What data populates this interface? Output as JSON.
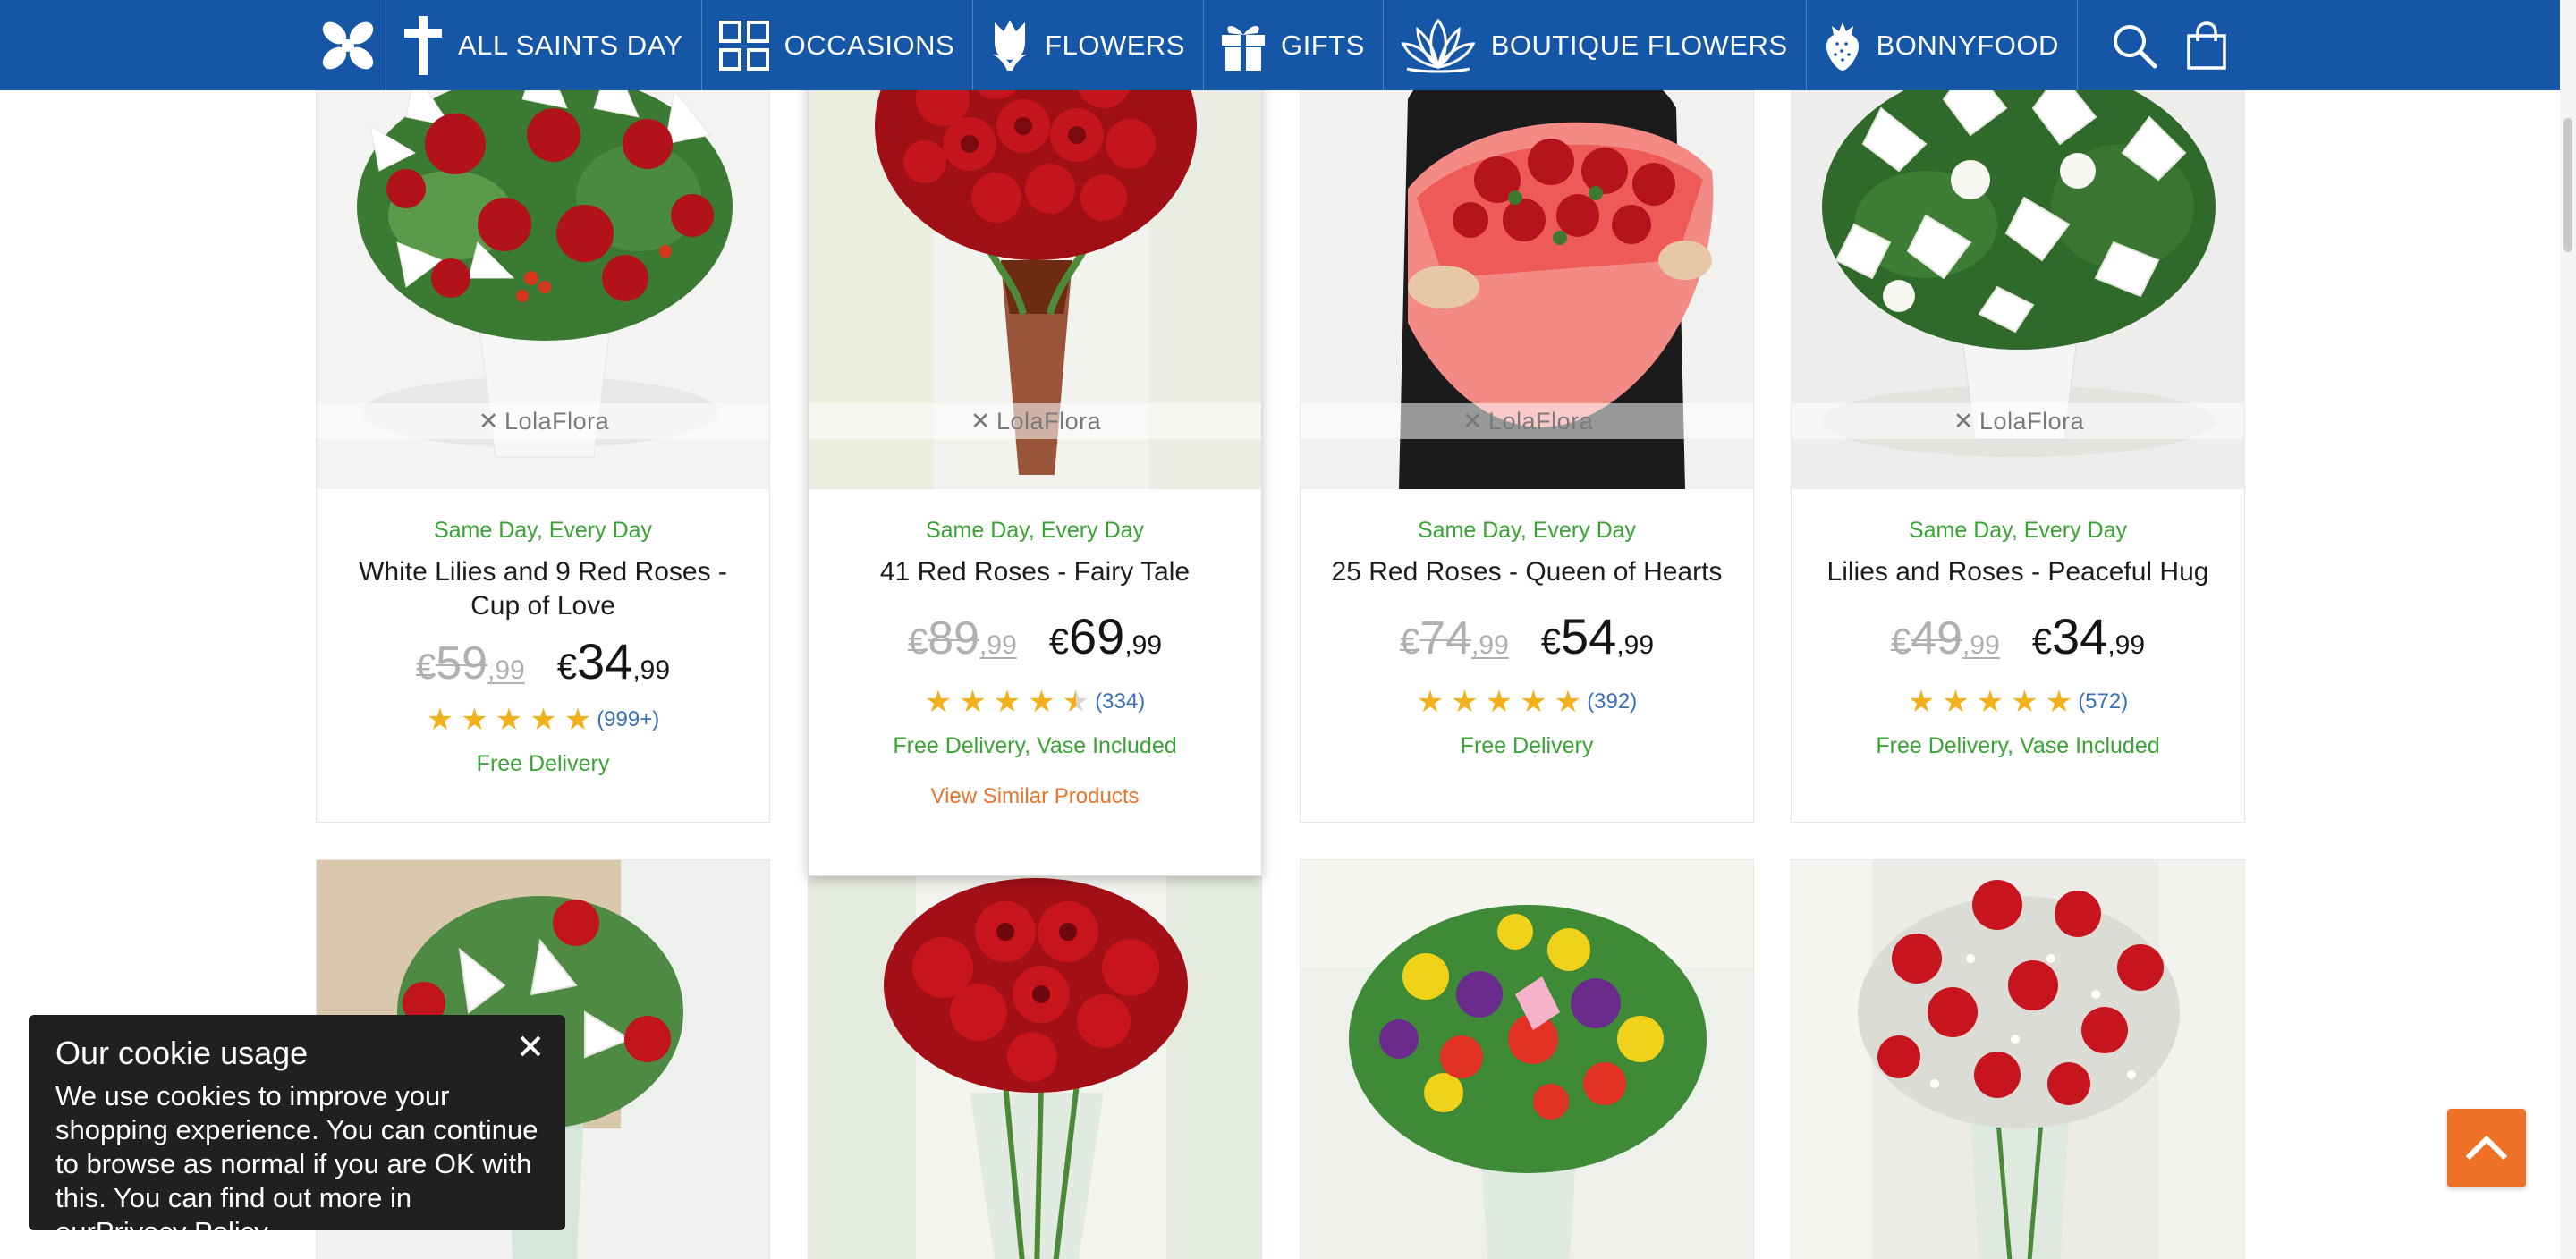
{
  "brand": {
    "name": "LolaFlora",
    "color": "#1557a6"
  },
  "nav": {
    "items": [
      {
        "label": "ALL SAINTS DAY",
        "icon": "cross-icon"
      },
      {
        "label": "OCCASIONS",
        "icon": "grid-icon"
      },
      {
        "label": "FLOWERS",
        "icon": "tulip-icon"
      },
      {
        "label": "GIFTS",
        "icon": "gift-icon"
      },
      {
        "label": "BOUTIQUE FLOWERS",
        "icon": "lotus-icon"
      },
      {
        "label": "BONNYFOOD",
        "icon": "strawberry-icon"
      }
    ],
    "search_icon": "search-icon",
    "cart_icon": "shopping-bag-icon"
  },
  "products": [
    {
      "delivery_time": "Same Day, Every Day",
      "name": "White Lilies and 9 Red Roses - Cup of Love",
      "old_price": {
        "currency": "€",
        "whole": "59",
        "cents": ",99"
      },
      "new_price": {
        "currency": "€",
        "whole": "34",
        "cents": ",99"
      },
      "rating": 5,
      "reviews": "(999+)",
      "delivery_note": "Free Delivery",
      "watermark": "LolaFlora"
    },
    {
      "delivery_time": "Same Day, Every Day",
      "name": "41 Red Roses - Fairy Tale",
      "old_price": {
        "currency": "€",
        "whole": "89",
        "cents": ",99"
      },
      "new_price": {
        "currency": "€",
        "whole": "69",
        "cents": ",99"
      },
      "rating": 4.5,
      "reviews": "(334)",
      "delivery_note": "Free Delivery, Vase Included",
      "similar_link": "View Similar Products",
      "watermark": "LolaFlora"
    },
    {
      "delivery_time": "Same Day, Every Day",
      "name": "25 Red Roses - Queen of Hearts",
      "old_price": {
        "currency": "€",
        "whole": "74",
        "cents": ",99"
      },
      "new_price": {
        "currency": "€",
        "whole": "54",
        "cents": ",99"
      },
      "rating": 5,
      "reviews": "(392)",
      "delivery_note": "Free Delivery",
      "watermark": "LolaFlora"
    },
    {
      "delivery_time": "Same Day, Every Day",
      "name": "Lilies and Roses - Peaceful Hug",
      "old_price": {
        "currency": "€",
        "whole": "49",
        "cents": ",99"
      },
      "new_price": {
        "currency": "€",
        "whole": "34",
        "cents": ",99"
      },
      "rating": 5,
      "reviews": "(572)",
      "delivery_note": "Free Delivery, Vase Included",
      "watermark": "LolaFlora"
    }
  ],
  "colors": {
    "green": "#3aa335",
    "star": "#f0b11c",
    "accent": "#f07228",
    "link": "#3b6fb6"
  },
  "cookie": {
    "title": "Our cookie usage",
    "text": "We use cookies to improve your shopping experience. You can continue to browse as normal if you are OK with this. You can find out more in our",
    "link": "Privacy Policy",
    "suffix": "."
  },
  "back_to_top_icon": "chevron-up-icon"
}
